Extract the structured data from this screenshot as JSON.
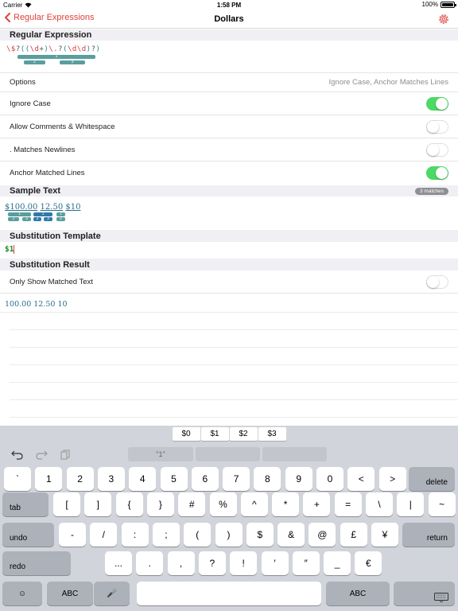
{
  "status": {
    "carrier": "Carrier",
    "time": "1:58 PM",
    "battery": "100%"
  },
  "nav": {
    "back_label": "Regular Expressions",
    "title": "Dollars"
  },
  "regex_section": {
    "header": "Regular Expression",
    "pattern_tokens": [
      {
        "t": "\\$",
        "c": "esc"
      },
      {
        "t": "?",
        "c": "plain"
      },
      {
        "t": "(",
        "c": "grp"
      },
      {
        "t": "(",
        "c": "grp"
      },
      {
        "t": "\\d",
        "c": "esc"
      },
      {
        "t": "+",
        "c": "plain"
      },
      {
        "t": ")",
        "c": "grp"
      },
      {
        "t": "\\.",
        "c": "esc"
      },
      {
        "t": "?",
        "c": "plain"
      },
      {
        "t": "(",
        "c": "grp"
      },
      {
        "t": "\\d\\d",
        "c": "esc"
      },
      {
        "t": ")",
        "c": "grp"
      },
      {
        "t": "?",
        "c": "plain"
      },
      {
        "t": ")",
        "c": "grp"
      }
    ],
    "group_labels": [
      "1",
      "2",
      "3"
    ]
  },
  "options": {
    "label": "Options",
    "summary": "Ignore Case, Anchor Matches Lines",
    "items": [
      {
        "label": "Ignore Case",
        "on": true
      },
      {
        "label": "Allow Comments & Whitespace",
        "on": false
      },
      {
        "label": ". Matches Newlines",
        "on": false
      },
      {
        "label": "Anchor Matched Lines",
        "on": true
      }
    ]
  },
  "sample": {
    "header": "Sample Text",
    "badge": "3 matches",
    "matches": [
      "$100.00",
      "12.50",
      "$10"
    ],
    "group_labels": [
      "1",
      "2",
      "3"
    ]
  },
  "substitution": {
    "header": "Substitution Template",
    "template": "$1"
  },
  "result": {
    "header": "Substitution Result",
    "only_matched_label": "Only Show Matched Text",
    "only_matched_on": false,
    "text": "100.00 12.50 10"
  },
  "keyboard": {
    "vars": [
      "$0",
      "$1",
      "$2",
      "$3"
    ],
    "suggestion": "\"1\"",
    "row1": [
      "`",
      "1",
      "2",
      "3",
      "4",
      "5",
      "6",
      "7",
      "8",
      "9",
      "0",
      "<",
      ">",
      "delete"
    ],
    "row2": [
      "tab",
      "[",
      "]",
      "{",
      "}",
      "#",
      "%",
      "^",
      "*",
      "+",
      "=",
      "\\",
      "|",
      "~"
    ],
    "row3": [
      "undo",
      "-",
      "/",
      ":",
      ";",
      "(",
      ")",
      "$",
      "&",
      "@",
      "£",
      "¥",
      "return"
    ],
    "row4": [
      "redo",
      "...",
      ".",
      ",",
      "?",
      "!",
      "′",
      "″",
      "_",
      "€"
    ],
    "row5": {
      "emoji": "☺",
      "abc_left": "ABC",
      "mic": "🎤",
      "abc_right": "ABC"
    }
  },
  "colors": {
    "accent": "#e0403a",
    "toggle_on": "#4cd964",
    "group_teal": "#5a9e9e",
    "match_blue": "#2a6f8e"
  }
}
